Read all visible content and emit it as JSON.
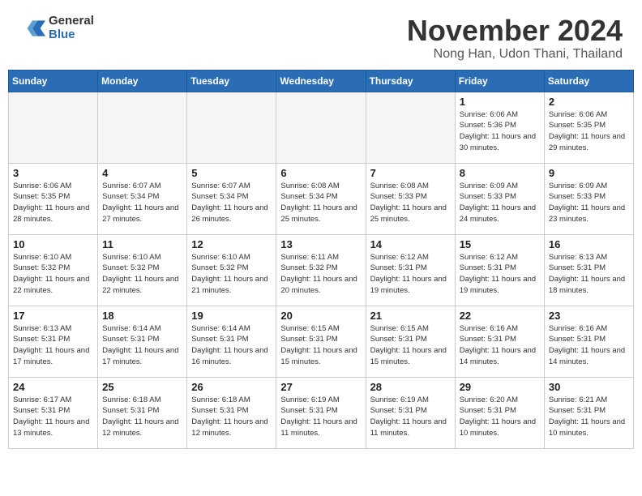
{
  "header": {
    "logo_general": "General",
    "logo_blue": "Blue",
    "month_title": "November 2024",
    "location": "Nong Han, Udon Thani, Thailand"
  },
  "weekdays": [
    "Sunday",
    "Monday",
    "Tuesday",
    "Wednesday",
    "Thursday",
    "Friday",
    "Saturday"
  ],
  "weeks": [
    [
      {
        "day": "",
        "info": ""
      },
      {
        "day": "",
        "info": ""
      },
      {
        "day": "",
        "info": ""
      },
      {
        "day": "",
        "info": ""
      },
      {
        "day": "",
        "info": ""
      },
      {
        "day": "1",
        "info": "Sunrise: 6:06 AM\nSunset: 5:36 PM\nDaylight: 11 hours\nand 30 minutes."
      },
      {
        "day": "2",
        "info": "Sunrise: 6:06 AM\nSunset: 5:35 PM\nDaylight: 11 hours\nand 29 minutes."
      }
    ],
    [
      {
        "day": "3",
        "info": "Sunrise: 6:06 AM\nSunset: 5:35 PM\nDaylight: 11 hours\nand 28 minutes."
      },
      {
        "day": "4",
        "info": "Sunrise: 6:07 AM\nSunset: 5:34 PM\nDaylight: 11 hours\nand 27 minutes."
      },
      {
        "day": "5",
        "info": "Sunrise: 6:07 AM\nSunset: 5:34 PM\nDaylight: 11 hours\nand 26 minutes."
      },
      {
        "day": "6",
        "info": "Sunrise: 6:08 AM\nSunset: 5:34 PM\nDaylight: 11 hours\nand 25 minutes."
      },
      {
        "day": "7",
        "info": "Sunrise: 6:08 AM\nSunset: 5:33 PM\nDaylight: 11 hours\nand 25 minutes."
      },
      {
        "day": "8",
        "info": "Sunrise: 6:09 AM\nSunset: 5:33 PM\nDaylight: 11 hours\nand 24 minutes."
      },
      {
        "day": "9",
        "info": "Sunrise: 6:09 AM\nSunset: 5:33 PM\nDaylight: 11 hours\nand 23 minutes."
      }
    ],
    [
      {
        "day": "10",
        "info": "Sunrise: 6:10 AM\nSunset: 5:32 PM\nDaylight: 11 hours\nand 22 minutes."
      },
      {
        "day": "11",
        "info": "Sunrise: 6:10 AM\nSunset: 5:32 PM\nDaylight: 11 hours\nand 22 minutes."
      },
      {
        "day": "12",
        "info": "Sunrise: 6:10 AM\nSunset: 5:32 PM\nDaylight: 11 hours\nand 21 minutes."
      },
      {
        "day": "13",
        "info": "Sunrise: 6:11 AM\nSunset: 5:32 PM\nDaylight: 11 hours\nand 20 minutes."
      },
      {
        "day": "14",
        "info": "Sunrise: 6:12 AM\nSunset: 5:31 PM\nDaylight: 11 hours\nand 19 minutes."
      },
      {
        "day": "15",
        "info": "Sunrise: 6:12 AM\nSunset: 5:31 PM\nDaylight: 11 hours\nand 19 minutes."
      },
      {
        "day": "16",
        "info": "Sunrise: 6:13 AM\nSunset: 5:31 PM\nDaylight: 11 hours\nand 18 minutes."
      }
    ],
    [
      {
        "day": "17",
        "info": "Sunrise: 6:13 AM\nSunset: 5:31 PM\nDaylight: 11 hours\nand 17 minutes."
      },
      {
        "day": "18",
        "info": "Sunrise: 6:14 AM\nSunset: 5:31 PM\nDaylight: 11 hours\nand 17 minutes."
      },
      {
        "day": "19",
        "info": "Sunrise: 6:14 AM\nSunset: 5:31 PM\nDaylight: 11 hours\nand 16 minutes."
      },
      {
        "day": "20",
        "info": "Sunrise: 6:15 AM\nSunset: 5:31 PM\nDaylight: 11 hours\nand 15 minutes."
      },
      {
        "day": "21",
        "info": "Sunrise: 6:15 AM\nSunset: 5:31 PM\nDaylight: 11 hours\nand 15 minutes."
      },
      {
        "day": "22",
        "info": "Sunrise: 6:16 AM\nSunset: 5:31 PM\nDaylight: 11 hours\nand 14 minutes."
      },
      {
        "day": "23",
        "info": "Sunrise: 6:16 AM\nSunset: 5:31 PM\nDaylight: 11 hours\nand 14 minutes."
      }
    ],
    [
      {
        "day": "24",
        "info": "Sunrise: 6:17 AM\nSunset: 5:31 PM\nDaylight: 11 hours\nand 13 minutes."
      },
      {
        "day": "25",
        "info": "Sunrise: 6:18 AM\nSunset: 5:31 PM\nDaylight: 11 hours\nand 12 minutes."
      },
      {
        "day": "26",
        "info": "Sunrise: 6:18 AM\nSunset: 5:31 PM\nDaylight: 11 hours\nand 12 minutes."
      },
      {
        "day": "27",
        "info": "Sunrise: 6:19 AM\nSunset: 5:31 PM\nDaylight: 11 hours\nand 11 minutes."
      },
      {
        "day": "28",
        "info": "Sunrise: 6:19 AM\nSunset: 5:31 PM\nDaylight: 11 hours\nand 11 minutes."
      },
      {
        "day": "29",
        "info": "Sunrise: 6:20 AM\nSunset: 5:31 PM\nDaylight: 11 hours\nand 10 minutes."
      },
      {
        "day": "30",
        "info": "Sunrise: 6:21 AM\nSunset: 5:31 PM\nDaylight: 11 hours\nand 10 minutes."
      }
    ]
  ]
}
